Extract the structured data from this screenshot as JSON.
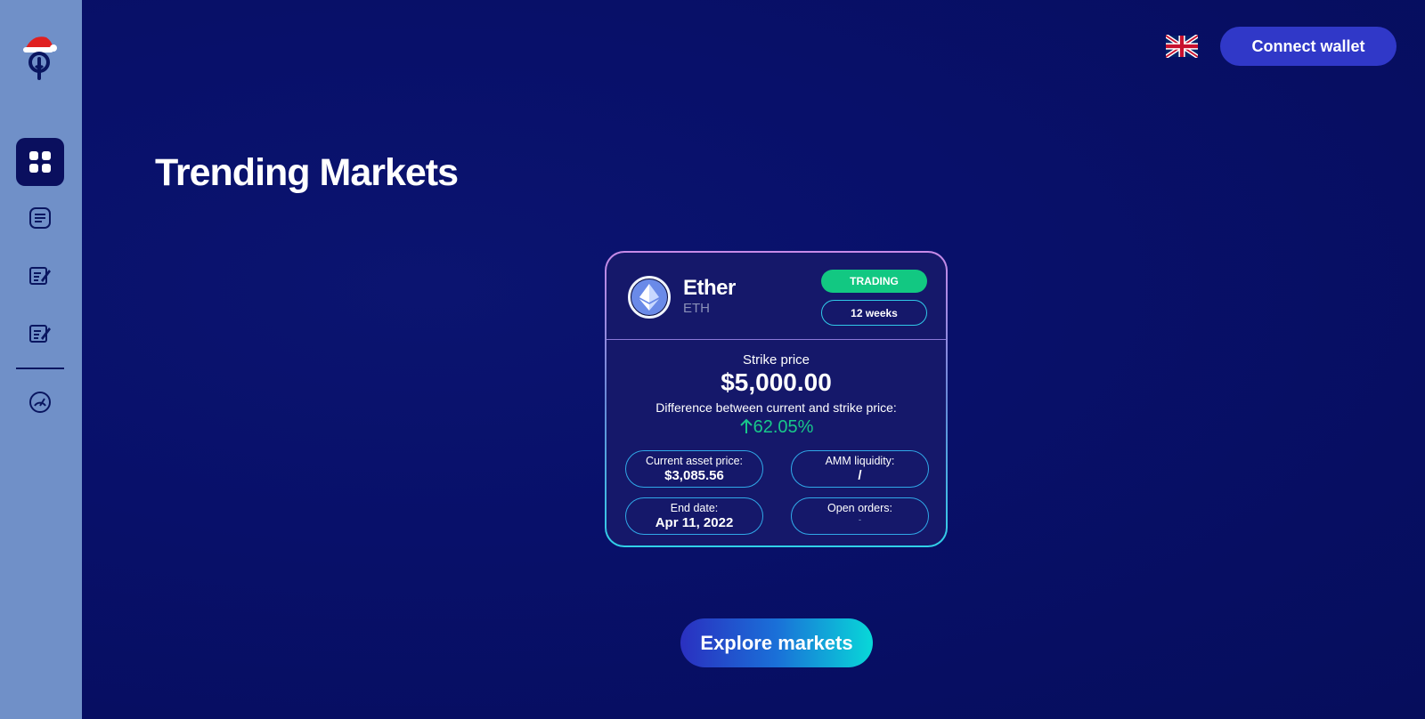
{
  "header": {
    "connect_wallet_label": "Connect wallet",
    "language_icon": "uk-flag-icon"
  },
  "sidebar": {
    "logo_icon": "santa-hat-logo-icon",
    "items": [
      {
        "icon": "grid-icon",
        "active": true
      },
      {
        "icon": "list-icon",
        "active": false
      },
      {
        "icon": "edit-note-icon",
        "active": false
      },
      {
        "icon": "edit-note-icon",
        "active": false
      },
      {
        "icon": "speedometer-icon",
        "active": false
      }
    ]
  },
  "main": {
    "title": "Trending Markets",
    "explore_label": "Explore markets"
  },
  "card": {
    "coin_name": "Ether",
    "coin_symbol": "ETH",
    "status_badge": "TRADING",
    "duration_badge": "12 weeks",
    "strike_label": "Strike price",
    "strike_value": "$5,000.00",
    "diff_label": "Difference between current and strike price:",
    "diff_value": "62.05%",
    "stats": [
      {
        "label": "Current asset price:",
        "value": "$3,085.56"
      },
      {
        "label": "AMM liquidity:",
        "value": "/"
      },
      {
        "label": "End date:",
        "value": "Apr 11, 2022"
      },
      {
        "label": "Open orders:",
        "value": "-"
      }
    ]
  },
  "colors": {
    "background": "#08106a",
    "sidebar": "#7090c8",
    "accent": "#3038c8",
    "trading_green": "#12c882",
    "up_green": "#18c88a",
    "cyan": "#30d0e8"
  }
}
